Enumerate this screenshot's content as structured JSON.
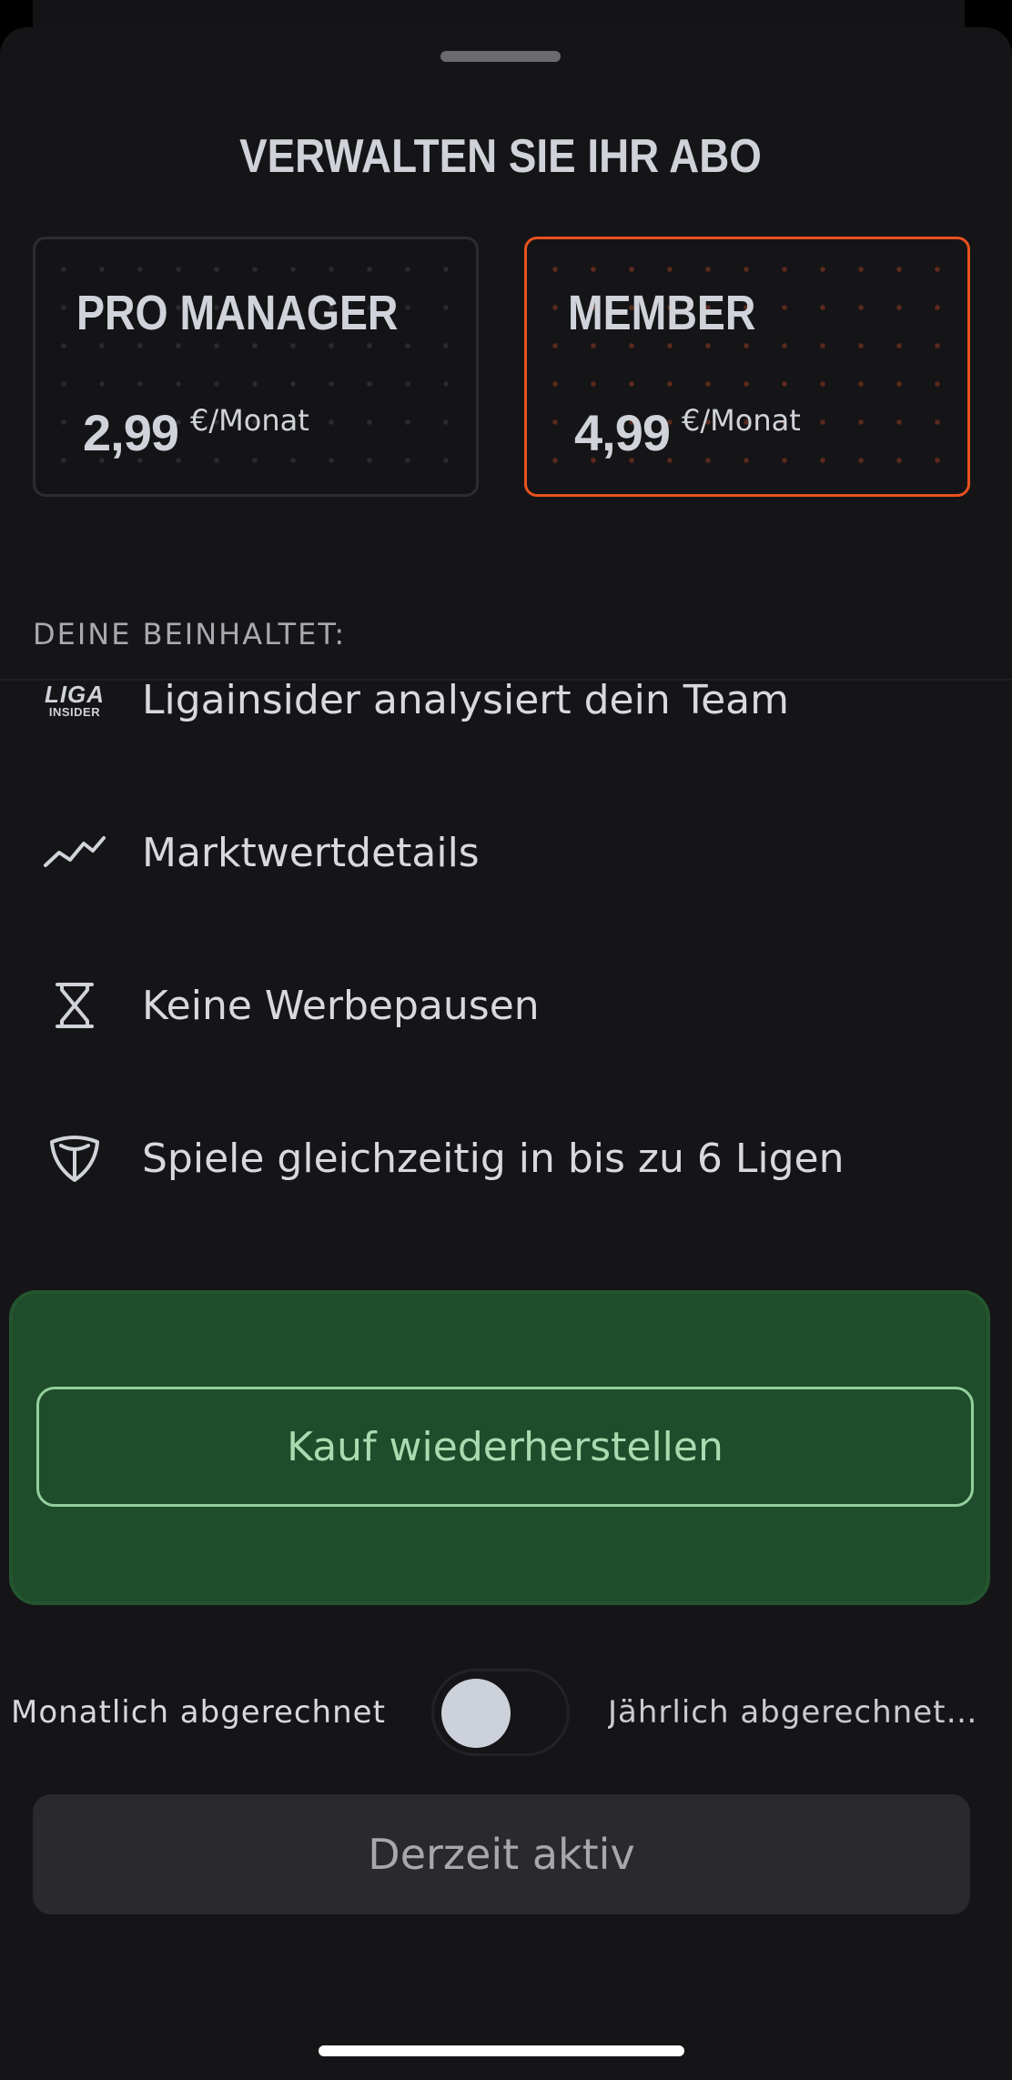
{
  "sheet": {
    "title": "VERWALTEN SIE IHR ABO"
  },
  "plans": [
    {
      "name": "PRO MANAGER",
      "price": "2,99",
      "unit": "€/Monat",
      "selected": false
    },
    {
      "name": "MEMBER",
      "price": "4,99",
      "unit": "€/Monat",
      "selected": true
    }
  ],
  "includes_label": "DEINE BEINHALTET:",
  "features": [
    {
      "icon": "ligainsider-logo-icon",
      "logo_line1": "LIGA",
      "logo_line2": "INSIDER",
      "label": "Ligainsider analysiert dein Team"
    },
    {
      "icon": "trend-line-icon",
      "label": "Marktwertdetails"
    },
    {
      "icon": "hourglass-icon",
      "label": "Keine Werbepausen"
    },
    {
      "icon": "shield-icon",
      "label": "Spiele gleichzeitig in bis zu 6 Ligen"
    }
  ],
  "restore_button": "Kauf wiederherstellen",
  "billing": {
    "monthly_label": "Monatlich abgerechnet",
    "yearly_label": "Jährlich abgerechnet…",
    "yearly_selected": false
  },
  "status_button": "Derzeit aktiv",
  "colors": {
    "accent_orange": "#e8521e",
    "panel_green": "#1f4c2b",
    "restore_border": "#93cf9c"
  }
}
